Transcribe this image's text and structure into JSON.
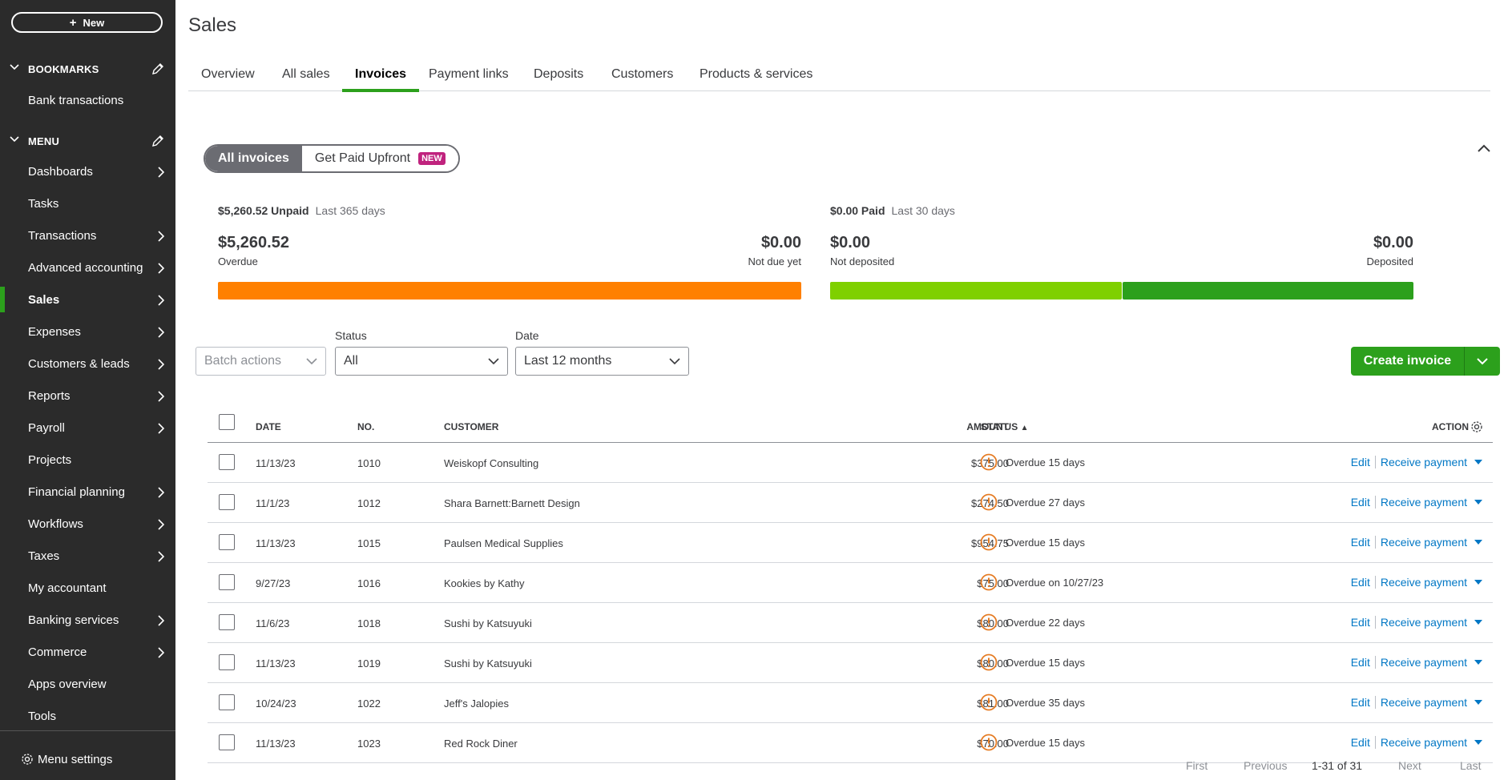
{
  "sidebar": {
    "new_label": "New",
    "bookmarks_header": "BOOKMARKS",
    "bookmarks": [
      {
        "label": "Bank transactions"
      }
    ],
    "menu_header": "MENU",
    "items": [
      {
        "label": "Dashboards",
        "arrow": true
      },
      {
        "label": "Tasks",
        "arrow": false
      },
      {
        "label": "Transactions",
        "arrow": true
      },
      {
        "label": "Advanced accounting",
        "arrow": true
      },
      {
        "label": "Sales",
        "arrow": true,
        "active": true
      },
      {
        "label": "Expenses",
        "arrow": true
      },
      {
        "label": "Customers & leads",
        "arrow": true
      },
      {
        "label": "Reports",
        "arrow": true
      },
      {
        "label": "Payroll",
        "arrow": true
      },
      {
        "label": "Projects",
        "arrow": false
      },
      {
        "label": "Financial planning",
        "arrow": true
      },
      {
        "label": "Workflows",
        "arrow": true
      },
      {
        "label": "Taxes",
        "arrow": true
      },
      {
        "label": "My accountant",
        "arrow": false
      },
      {
        "label": "Banking services",
        "arrow": true
      },
      {
        "label": "Commerce",
        "arrow": true
      },
      {
        "label": "Apps overview",
        "arrow": false
      },
      {
        "label": "Tools",
        "arrow": false
      }
    ],
    "settings_label": "Menu settings"
  },
  "page": {
    "title": "Sales"
  },
  "tabs": [
    {
      "label": "Overview"
    },
    {
      "label": "All sales"
    },
    {
      "label": "Invoices",
      "active": true
    },
    {
      "label": "Payment links"
    },
    {
      "label": "Deposits"
    },
    {
      "label": "Customers"
    },
    {
      "label": "Products & services"
    }
  ],
  "segment": {
    "all_invoices": "All invoices",
    "get_paid": "Get Paid Upfront",
    "new_badge": "NEW"
  },
  "summary": {
    "unpaid": {
      "title_amount": "$5,260.52 Unpaid",
      "period": "Last 365 days",
      "overdue_amount": "$5,260.52",
      "overdue_label": "Overdue",
      "not_due_amount": "$0.00",
      "not_due_label": "Not due yet"
    },
    "paid": {
      "title_amount": "$0.00 Paid",
      "period": "Last 30 days",
      "not_deposited_amount": "$0.00",
      "not_deposited_label": "Not deposited",
      "deposited_amount": "$0.00",
      "deposited_label": "Deposited"
    },
    "colors": {
      "overdue": "#ff8000",
      "not_deposited": "#7fd000",
      "deposited": "#2ca01c"
    }
  },
  "filters": {
    "batch_actions": "Batch actions",
    "status_label": "Status",
    "status_value": "All",
    "date_label": "Date",
    "date_value": "Last 12 months"
  },
  "create_invoice_label": "Create invoice",
  "table": {
    "headers": {
      "date": "DATE",
      "no": "NO.",
      "customer": "CUSTOMER",
      "amount": "AMOUNT",
      "status": "STATUS",
      "status_sort": "▲",
      "action": "ACTION"
    },
    "action_labels": {
      "edit": "Edit",
      "receive": "Receive payment"
    },
    "rows": [
      {
        "date": "11/13/23",
        "no": "1010",
        "customer": "Weiskopf Consulting",
        "amount": "$375.00",
        "status": "Overdue 15 days"
      },
      {
        "date": "11/1/23",
        "no": "1012",
        "customer": "Shara Barnett:Barnett Design",
        "amount": "$274.50",
        "status": "Overdue 27 days"
      },
      {
        "date": "11/13/23",
        "no": "1015",
        "customer": "Paulsen Medical Supplies",
        "amount": "$954.75",
        "status": "Overdue 15 days"
      },
      {
        "date": "9/27/23",
        "no": "1016",
        "customer": "Kookies by Kathy",
        "amount": "$75.00",
        "status": "Overdue on 10/27/23"
      },
      {
        "date": "11/6/23",
        "no": "1018",
        "customer": "Sushi by Katsuyuki",
        "amount": "$80.00",
        "status": "Overdue 22 days"
      },
      {
        "date": "11/13/23",
        "no": "1019",
        "customer": "Sushi by Katsuyuki",
        "amount": "$80.00",
        "status": "Overdue 15 days"
      },
      {
        "date": "10/24/23",
        "no": "1022",
        "customer": "Jeff's Jalopies",
        "amount": "$81.00",
        "status": "Overdue 35 days"
      },
      {
        "date": "11/13/23",
        "no": "1023",
        "customer": "Red Rock Diner",
        "amount": "$70.00",
        "status": "Overdue 15 days"
      }
    ]
  },
  "pager": {
    "first": "First",
    "previous": "Previous",
    "count": "1-31 of 31",
    "next": "Next",
    "last": "Last"
  }
}
